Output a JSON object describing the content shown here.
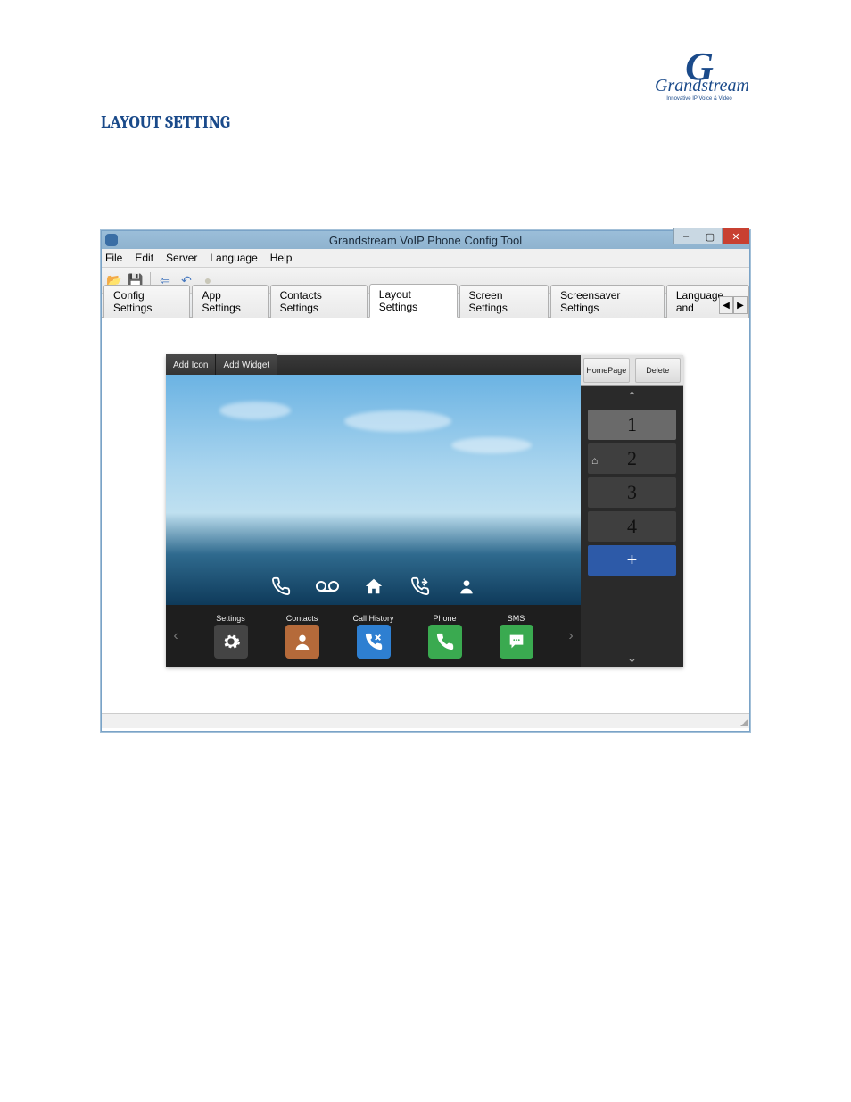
{
  "logo": {
    "brand": "Grandstream",
    "tagline": "Innovative IP Voice & Video"
  },
  "page_title": "LAYOUT SETTING",
  "window": {
    "title": "Grandstream VoIP Phone Config Tool",
    "controls": {
      "minimize": "–",
      "maximize": "▢",
      "close": "✕"
    }
  },
  "menubar": [
    "File",
    "Edit",
    "Server",
    "Language",
    "Help"
  ],
  "toolbar": {
    "open_icon": "📂",
    "save_icon": "💾",
    "back_icon": "⇦",
    "undo_icon": "↶",
    "stop_icon": "●"
  },
  "tabs": {
    "items": [
      "Config Settings",
      "App Settings",
      "Contacts Settings",
      "Layout Settings",
      "Screen Settings",
      "Screensaver Settings",
      "Language and"
    ],
    "active_index": 3,
    "scroll_left": "◀",
    "scroll_right": "▶"
  },
  "layout_editor": {
    "top_buttons": {
      "add_icon": "Add Icon",
      "add_widget": "Add Widget"
    },
    "dock": {
      "phone_icon": "phone",
      "voicemail_icon": "voicemail",
      "home_icon": "home",
      "callredir_icon": "call-redirect",
      "person_icon": "person"
    },
    "apps": [
      {
        "label": "Settings",
        "glyph": "✻",
        "class": "ic-settings"
      },
      {
        "label": "Contacts",
        "glyph": "👤",
        "class": "ic-contacts"
      },
      {
        "label": "Call History",
        "glyph": "☏",
        "class": "ic-callhist"
      },
      {
        "label": "Phone",
        "glyph": "✆",
        "class": "ic-phone"
      },
      {
        "label": "SMS",
        "glyph": "⋯",
        "class": "ic-sms"
      }
    ],
    "prev_arrow": "‹",
    "next_arrow": "›",
    "side": {
      "homepage": "HomePage",
      "delete": "Delete",
      "up": "⌃",
      "down": "⌄",
      "pages": [
        "1",
        "2",
        "3",
        "4"
      ],
      "selected_page_index": 0,
      "home_marker_page_index": 1,
      "add": "+"
    }
  }
}
